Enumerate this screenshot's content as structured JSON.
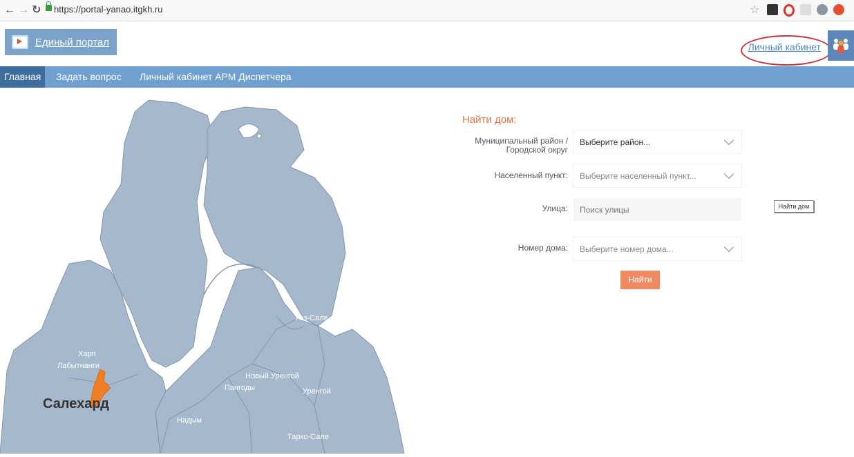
{
  "browser": {
    "url": "https://portal-yanao.itgkh.ru"
  },
  "header": {
    "logo_label": "Единый портал",
    "cabinet_link": "Личный кабинет"
  },
  "menu": {
    "items": [
      "Главная",
      "Задать вопрос",
      "Личный кабинет АРМ Диспетчера"
    ]
  },
  "map": {
    "labels": {
      "gaz_sale": "Газ-Сале",
      "harp": "Харп",
      "labytnangi": "Лабытнанги",
      "novy_urengoy": "Новый Уренгой",
      "pangody": "Пангоды",
      "urengoy": "Уренгой",
      "salekhard": "Салехард",
      "nadym": "Надым",
      "tarko_sale": "Тарко-Сале"
    }
  },
  "search": {
    "title": "Найти дом:",
    "district_label_1": "Муниципальный район /",
    "district_label_2": "Городской округ",
    "district_value": "Выберите район...",
    "locality_label": "Населенный пункт:",
    "locality_value": "Выберите населенный пункт...",
    "street_label": "Улица:",
    "street_placeholder": "Поиск улицы",
    "house_label": "Номер дома:",
    "house_value": "Выберите номер дома...",
    "find_button": "Найти",
    "tooltip": "Найти дом"
  }
}
